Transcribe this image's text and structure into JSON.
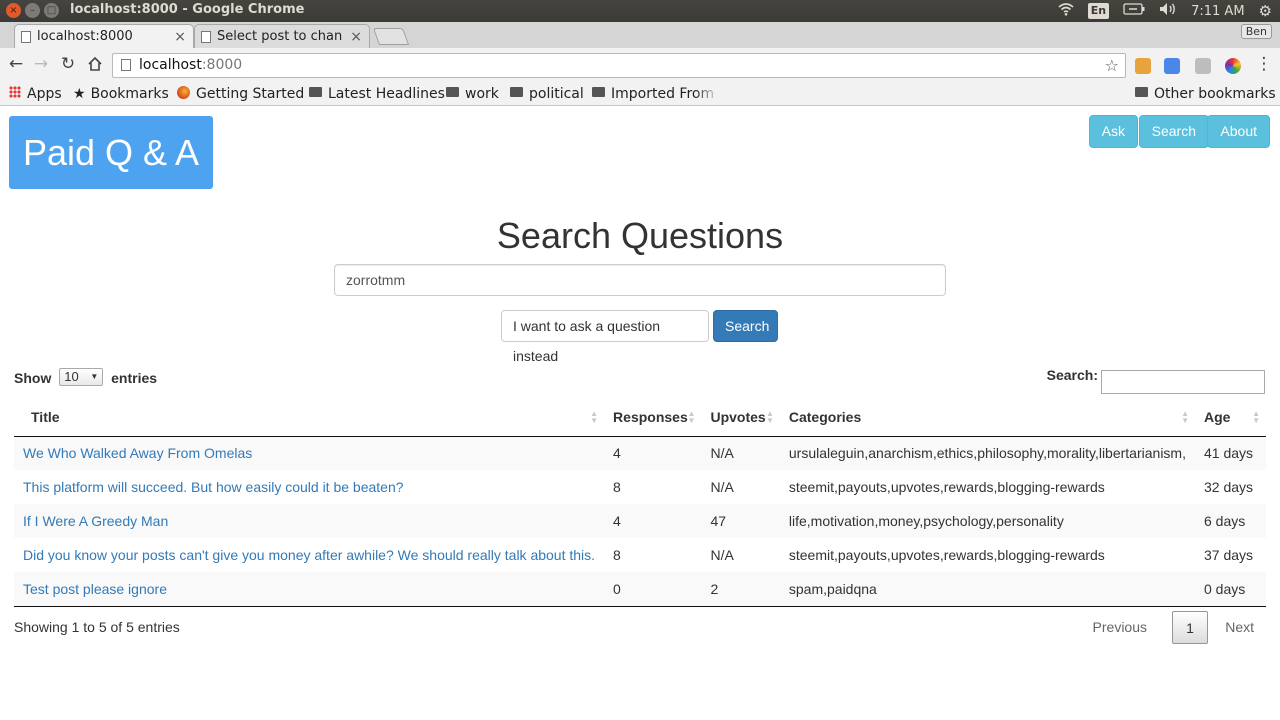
{
  "os": {
    "window_title": "localhost:8000 - Google Chrome",
    "input_method": "En",
    "time": "7:11 AM"
  },
  "browser": {
    "tabs": [
      {
        "label": "localhost:8000",
        "active": true
      },
      {
        "label": "Select post to chan",
        "active": false
      }
    ],
    "profile": "Ben",
    "url_host": "localhost",
    "url_port": ":8000",
    "bookmarks": {
      "apps": "Apps",
      "items": [
        "Bookmarks",
        "Getting Started",
        "Latest Headlines",
        "work",
        "political",
        "Imported From Fi"
      ],
      "other": "Other bookmarks"
    }
  },
  "site": {
    "logo": "Paid Q & A",
    "nav": [
      "Ask",
      "Search",
      "About"
    ]
  },
  "search": {
    "heading": "Search Questions",
    "query": "zorrotmm",
    "ask_instead_label": "I want to ask a question instead",
    "search_label": "Search"
  },
  "table": {
    "length_prefix": "Show",
    "length_value": "10",
    "length_suffix": "entries",
    "filter_label": "Search:",
    "columns": [
      "Title",
      "Responses",
      "Upvotes",
      "Categories",
      "Age"
    ],
    "rows": [
      {
        "title": "We Who Walked Away From Omelas",
        "responses": "4",
        "upvotes": "N/A",
        "categories": "ursulaleguin,anarchism,ethics,philosophy,morality,libertarianism,",
        "age": "41 days"
      },
      {
        "title": "This platform will succeed. But how easily could it be beaten?",
        "responses": "8",
        "upvotes": "N/A",
        "categories": "steemit,payouts,upvotes,rewards,blogging-rewards",
        "age": "32 days"
      },
      {
        "title": "If I Were A Greedy Man",
        "responses": "4",
        "upvotes": "47",
        "categories": "life,motivation,money,psychology,personality",
        "age": "6 days"
      },
      {
        "title": "Did you know your posts can't give you money after awhile? We should really talk about this.",
        "responses": "8",
        "upvotes": "N/A",
        "categories": "steemit,payouts,upvotes,rewards,blogging-rewards",
        "age": "37 days"
      },
      {
        "title": "Test post please ignore",
        "responses": "0",
        "upvotes": "2",
        "categories": "spam,paidqna",
        "age": "0 days"
      }
    ],
    "info": "Showing 1 to 5 of 5 entries",
    "pagination": {
      "previous": "Previous",
      "page": "1",
      "next": "Next"
    }
  },
  "colors": {
    "logo_bg": "#4da3f0",
    "nav_btn": "#5bc0de",
    "primary": "#337ab7",
    "link": "#337ab7"
  }
}
